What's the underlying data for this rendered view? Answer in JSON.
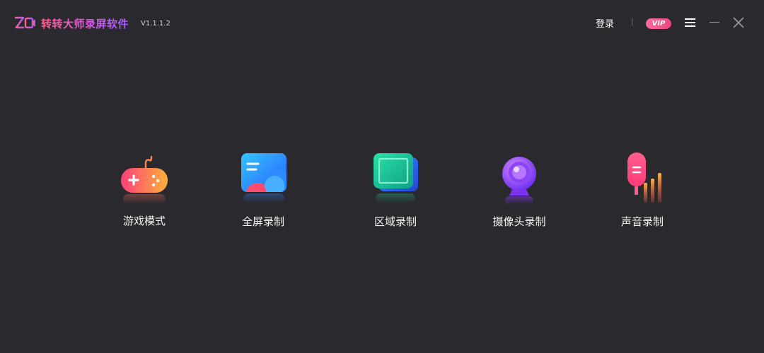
{
  "app": {
    "title": "转转大师录屏软件",
    "version": "V1.1.1.2"
  },
  "header": {
    "login_label": "登录",
    "vip_label": "VIP"
  },
  "modes": [
    {
      "id": "game",
      "label": "游戏模式",
      "icon": "gamepad-icon"
    },
    {
      "id": "fullscreen",
      "label": "全屏录制",
      "icon": "fullscreen-icon"
    },
    {
      "id": "region",
      "label": "区域录制",
      "icon": "region-icon"
    },
    {
      "id": "camera",
      "label": "摄像头录制",
      "icon": "webcam-icon"
    },
    {
      "id": "audio",
      "label": "声音录制",
      "icon": "microphone-icon"
    }
  ],
  "colors": {
    "background": "#2a292d",
    "brand_pink": "#ff5f8e",
    "brand_purple": "#a45cff",
    "vip": "#f05a8c"
  }
}
